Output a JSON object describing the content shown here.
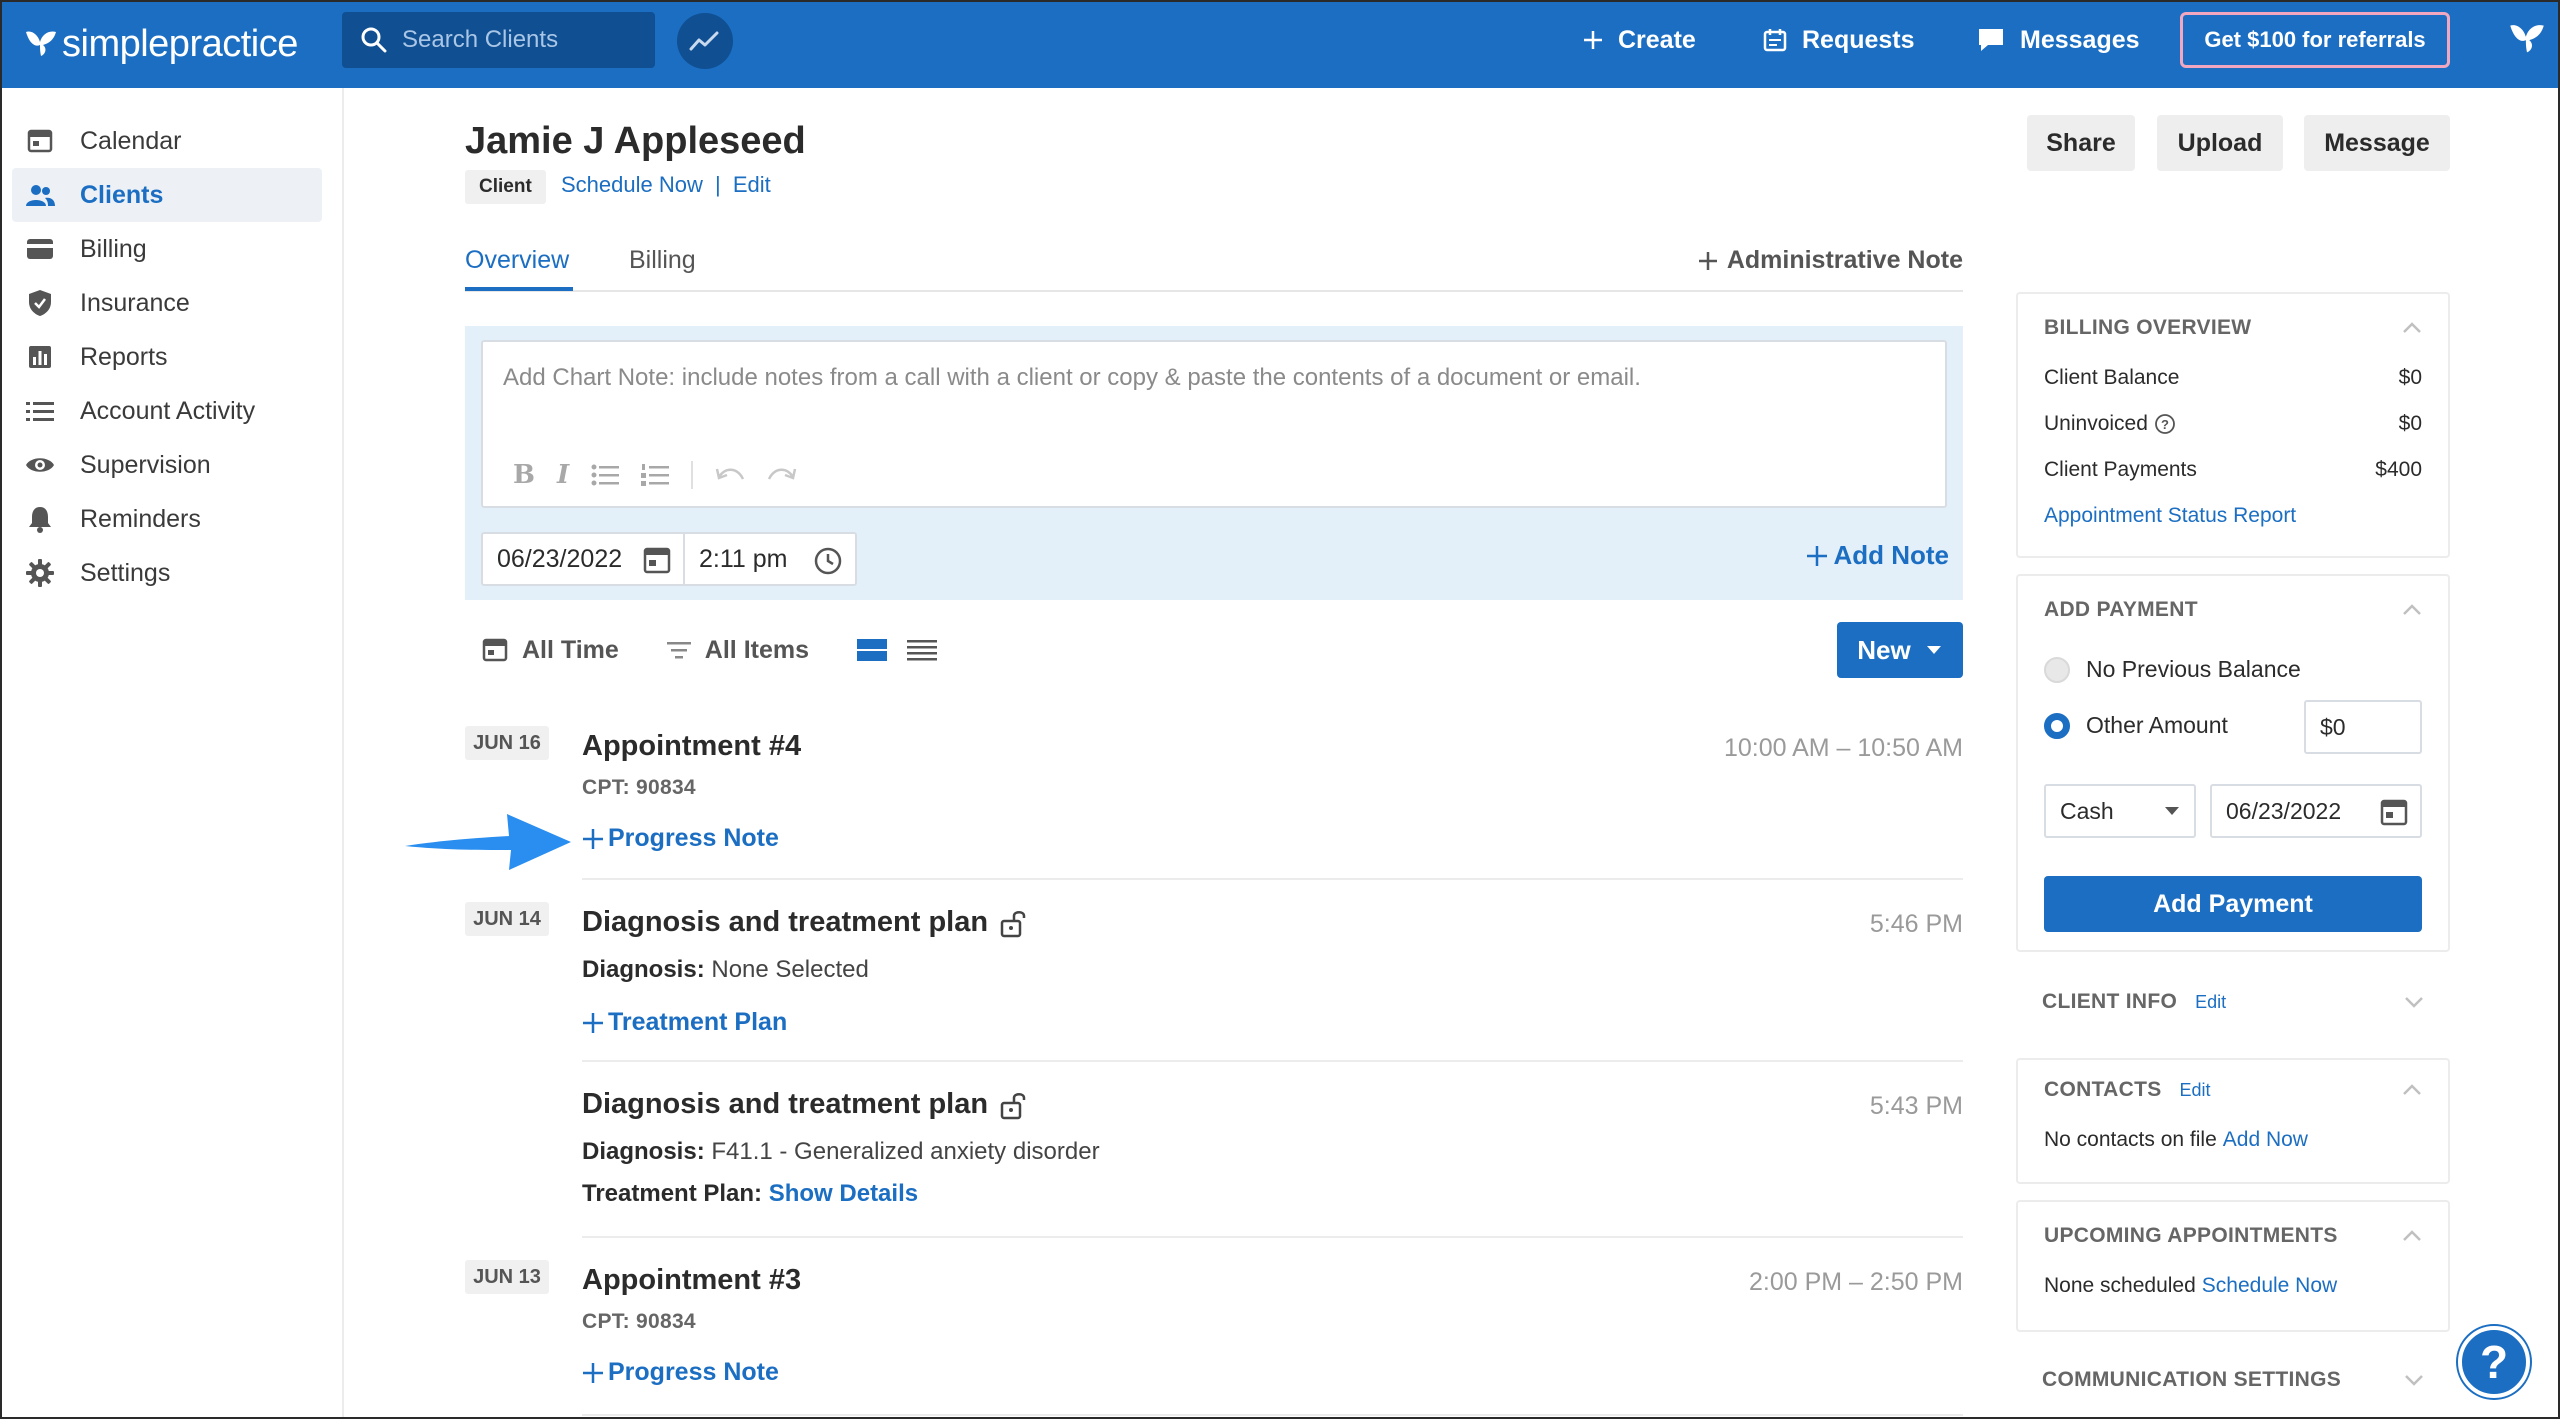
{
  "brand": {
    "name": "simplepractice",
    "accent": "#1b6ec2"
  },
  "topbar": {
    "search_placeholder": "Search Clients",
    "create": "Create",
    "requests": "Requests",
    "messages": "Messages",
    "referral": "Get $100 for referrals"
  },
  "sidebar": {
    "items": [
      {
        "label": "Calendar",
        "icon": "calendar-icon"
      },
      {
        "label": "Clients",
        "icon": "users-icon"
      },
      {
        "label": "Billing",
        "icon": "credit-card-icon"
      },
      {
        "label": "Insurance",
        "icon": "shield-icon"
      },
      {
        "label": "Reports",
        "icon": "bar-chart-icon"
      },
      {
        "label": "Account Activity",
        "icon": "list-icon"
      },
      {
        "label": "Supervision",
        "icon": "eye-icon"
      },
      {
        "label": "Reminders",
        "icon": "bell-icon"
      },
      {
        "label": "Settings",
        "icon": "gear-icon"
      }
    ]
  },
  "client": {
    "name": "Jamie J Appleseed",
    "badge": "Client",
    "schedule_now": "Schedule Now",
    "separator": "|",
    "edit": "Edit"
  },
  "header_buttons": {
    "share": "Share",
    "upload": "Upload",
    "message": "Message"
  },
  "tabs": {
    "overview": "Overview",
    "billing": "Billing",
    "admin_note": "Administrative Note"
  },
  "chart_note": {
    "placeholder": "Add Chart Note: include notes from a call with a client or copy & paste the contents of a document or email.",
    "date": "06/23/2022",
    "time": "2:11 pm",
    "add_note": "Add Note"
  },
  "filters": {
    "time": "All Time",
    "items": "All Items",
    "new": "New"
  },
  "feed": [
    {
      "date": "JUN 16",
      "title": "Appointment #4",
      "time": "10:00 AM – 10:50 AM",
      "cpt": "CPT: 90834",
      "link": "Progress Note"
    },
    {
      "date": "JUN 14",
      "title": "Diagnosis and treatment plan",
      "time": "5:46 PM",
      "diag_label": "Diagnosis:",
      "diag_value": "None Selected",
      "link": "Treatment Plan"
    },
    {
      "title": "Diagnosis and treatment plan",
      "time": "5:43 PM",
      "diag_label": "Diagnosis:",
      "diag_value": "F41.1 - Generalized anxiety disorder",
      "plan_label": "Treatment Plan:",
      "plan_link": "Show Details"
    },
    {
      "date": "JUN 13",
      "title": "Appointment #3",
      "time": "2:00 PM – 2:50 PM",
      "cpt": "CPT: 90834",
      "link": "Progress Note"
    }
  ],
  "billing_overview": {
    "title": "BILLING OVERVIEW",
    "rows": [
      {
        "label": "Client Balance",
        "value": "$0"
      },
      {
        "label": "Uninvoiced",
        "value": "$0"
      },
      {
        "label": "Client Payments",
        "value": "$400"
      }
    ],
    "link": "Appointment Status Report"
  },
  "add_payment": {
    "title": "ADD PAYMENT",
    "option_1": "No Previous Balance",
    "option_2": "Other Amount",
    "amount": "$0",
    "method": "Cash",
    "date": "06/23/2022",
    "button": "Add Payment"
  },
  "client_info": {
    "title": "CLIENT INFO",
    "edit": "Edit"
  },
  "contacts": {
    "title": "CONTACTS",
    "edit": "Edit",
    "text": "No contacts on file",
    "link": "Add Now"
  },
  "upcoming": {
    "title": "UPCOMING APPOINTMENTS",
    "text": "None scheduled",
    "link": "Schedule Now"
  },
  "communication": {
    "title": "COMMUNICATION SETTINGS"
  },
  "help": "?"
}
